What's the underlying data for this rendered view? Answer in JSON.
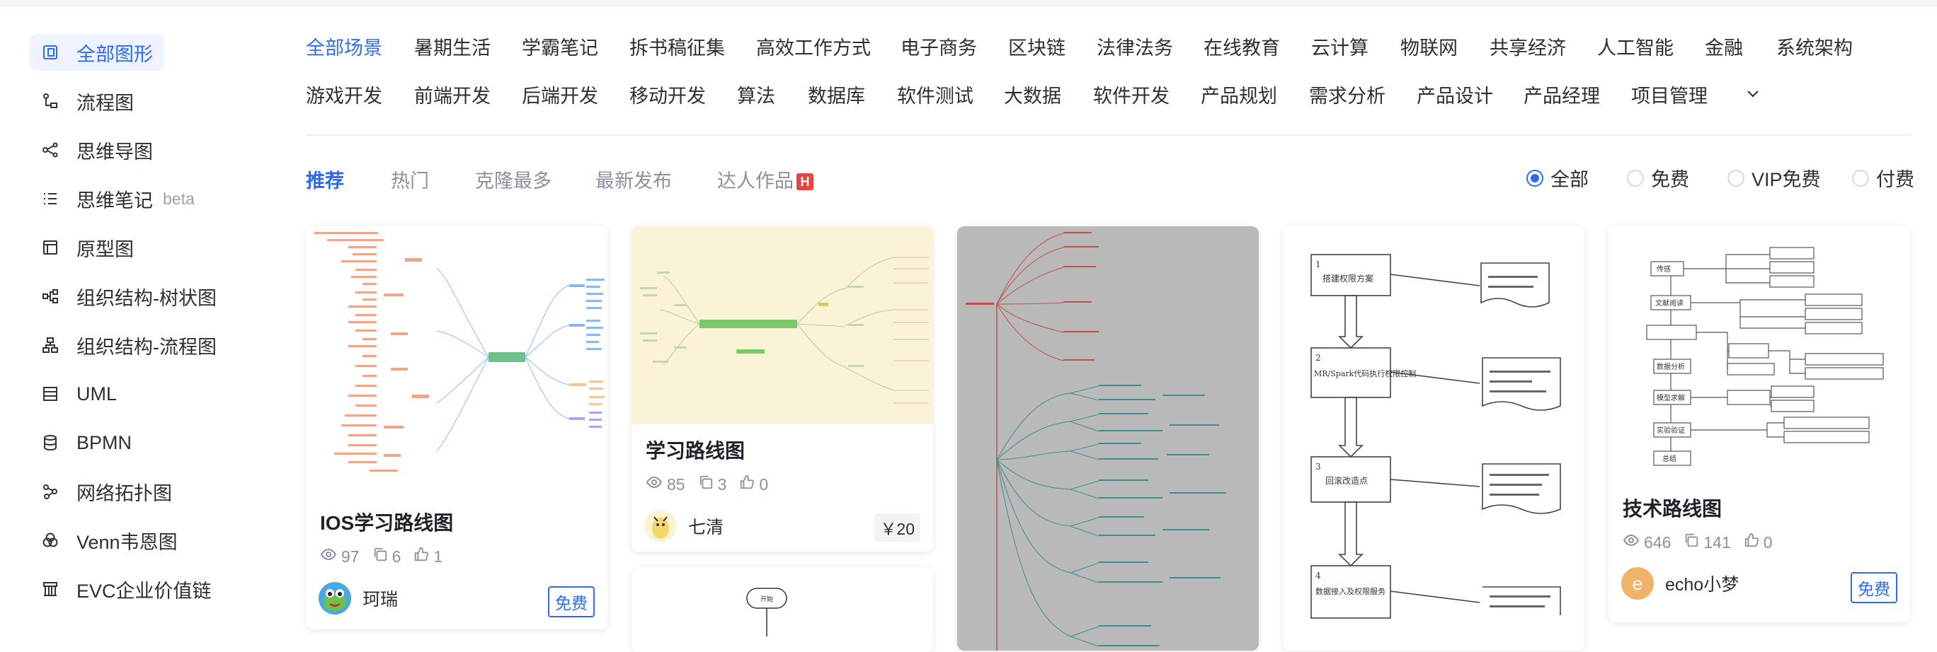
{
  "sidebar": {
    "items": [
      {
        "label": "全部图形",
        "icon": "all-shapes-icon",
        "active": true
      },
      {
        "label": "流程图",
        "icon": "flowchart-icon"
      },
      {
        "label": "思维导图",
        "icon": "mindmap-icon"
      },
      {
        "label": "思维笔记",
        "icon": "list-icon",
        "badge": "beta"
      },
      {
        "label": "原型图",
        "icon": "prototype-icon"
      },
      {
        "label": "组织结构-树状图",
        "icon": "org-tree-icon"
      },
      {
        "label": "组织结构-流程图",
        "icon": "org-flow-icon"
      },
      {
        "label": "UML",
        "icon": "uml-icon"
      },
      {
        "label": "BPMN",
        "icon": "database-icon"
      },
      {
        "label": "网络拓扑图",
        "icon": "network-icon"
      },
      {
        "label": "Venn韦恩图",
        "icon": "venn-icon"
      },
      {
        "label": "EVC企业价值链",
        "icon": "evc-icon"
      }
    ]
  },
  "categories": {
    "row1": [
      "全部场景",
      "暑期生活",
      "学霸笔记",
      "拆书稿征集",
      "高效工作方式",
      "电子商务",
      "区块链",
      "法律法务",
      "在线教育",
      "云计算",
      "物联网",
      "共享经济",
      "人工智能",
      "金融",
      "系统架构"
    ],
    "row2": [
      "游戏开发",
      "前端开发",
      "后端开发",
      "移动开发",
      "算法",
      "数据库",
      "软件测试",
      "大数据",
      "软件开发",
      "产品规划",
      "需求分析",
      "产品设计",
      "产品经理",
      "项目管理"
    ],
    "active": "全部场景"
  },
  "sort_tabs": [
    "推荐",
    "热门",
    "克隆最多",
    "最新发布",
    "达人作品"
  ],
  "sort_badge": "H",
  "price_filter": [
    "全部",
    "免费",
    "VIP免费",
    "付费"
  ],
  "cards": [
    {
      "title": "IOS学习路线图",
      "views": "97",
      "clones": "6",
      "likes": "1",
      "author": "珂瑞",
      "price": "免费"
    },
    {
      "title": "学习路线图",
      "views": "85",
      "clones": "3",
      "likes": "0",
      "author": "七清",
      "price": "￥20"
    },
    {
      "title": "",
      "views": "",
      "clones": "",
      "likes": "",
      "author": "",
      "price": ""
    },
    {
      "title": "",
      "views": "",
      "clones": "",
      "likes": "",
      "author": "",
      "price": ""
    },
    {
      "title": "技术路线图",
      "views": "646",
      "clones": "141",
      "likes": "0",
      "author": "echo小梦",
      "avatar_letter": "e",
      "price": "免费"
    }
  ],
  "thumb_texts": {
    "flow1": [
      "1",
      "搭建权限方案",
      "2",
      "MR/Spark代码执行权限控制",
      "3",
      "回滚改造点",
      "4",
      "数据接入及权限服务"
    ],
    "flow2": [
      "传感",
      "文献阅读",
      "数据分析",
      "模型求解",
      "实验验证",
      "总结"
    ]
  },
  "colors": {
    "accent": "#2e6bf0",
    "hot_badge": "#e8453c"
  }
}
